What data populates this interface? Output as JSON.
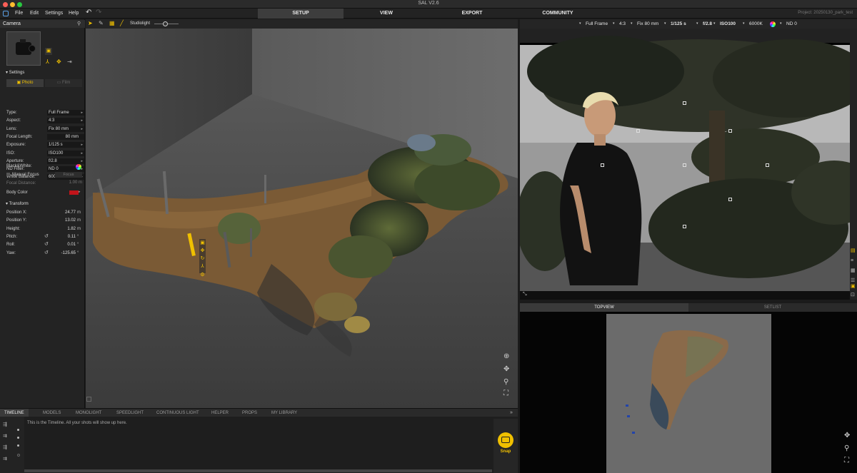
{
  "app": {
    "title": "SAL V2.6",
    "project": "Project: 20250130_park_test"
  },
  "menu": [
    "File",
    "Edit",
    "Settings",
    "Help"
  ],
  "top_tabs": [
    "SETUP",
    "VIEW",
    "EXPORT",
    "COMMUNITY"
  ],
  "active_tab": "SETUP",
  "camera_panel": {
    "title": "Camera",
    "settings_label": "Settings",
    "photo_label": "Photo",
    "film_label": "Film",
    "props": [
      {
        "label": "Type:",
        "value": "Full Frame"
      },
      {
        "label": "Aspect:",
        "value": "4:3"
      },
      {
        "label": "Lens:",
        "value": "Fix 80 mm"
      },
      {
        "label": "Focal Length:",
        "value": "80",
        "unit": "mm"
      },
      {
        "label": "Exposure:",
        "value": "1/125 s"
      },
      {
        "label": "ISO:",
        "value": "ISO100"
      },
      {
        "label": "Aperture:",
        "value": "f/2.8"
      },
      {
        "label": "ND Filter:",
        "value": "ND 0"
      },
      {
        "label": "White Balance:",
        "value": "6000K"
      }
    ],
    "bw_label": "Black&White:",
    "manual_focus": "Manual Focus",
    "focus_btn": "Focus",
    "focal_distance_label": "Focal Distance:",
    "focal_distance_value": "1.00",
    "focal_distance_unit": "m",
    "body_color_label": "Body Color",
    "body_color": "#c0141a",
    "transform_label": "Transform",
    "transform": [
      {
        "label": "Position X:",
        "value": "24.77",
        "unit": "m"
      },
      {
        "label": "Position Y:",
        "value": "13.02",
        "unit": "m"
      },
      {
        "label": "Height:",
        "value": "1.82",
        "unit": "m"
      },
      {
        "label": "Pitch:",
        "value": "0.11",
        "unit": "°"
      },
      {
        "label": "Roll:",
        "value": "0.01",
        "unit": "°"
      },
      {
        "label": "Yaw:",
        "value": "-125.65",
        "unit": "°"
      }
    ]
  },
  "view_toolbar": {
    "light_label": "Studiolight",
    "light_level": 0.45
  },
  "cam_toolbar": [
    "Full Frame",
    "4:3",
    "Fix 80 mm",
    "1/125 s",
    "f/2.8",
    "ISO100",
    "6000K",
    "ND 0"
  ],
  "topview_tabs": [
    "TOPVIEW",
    "SETLIST"
  ],
  "bottom_tabs": [
    "TIMELINE",
    "MODELS",
    "MONOLIGHT",
    "SPEEDLIGHT",
    "CONTINUOUS LIGHT",
    "HELPER",
    "PROPS",
    "MY LIBRARY"
  ],
  "timeline_msg": "This is the Timeline. All your shots will show up here.",
  "snap_label": "Snap",
  "colors": {
    "accent": "#f0c000",
    "body_color": "#c0141a"
  }
}
